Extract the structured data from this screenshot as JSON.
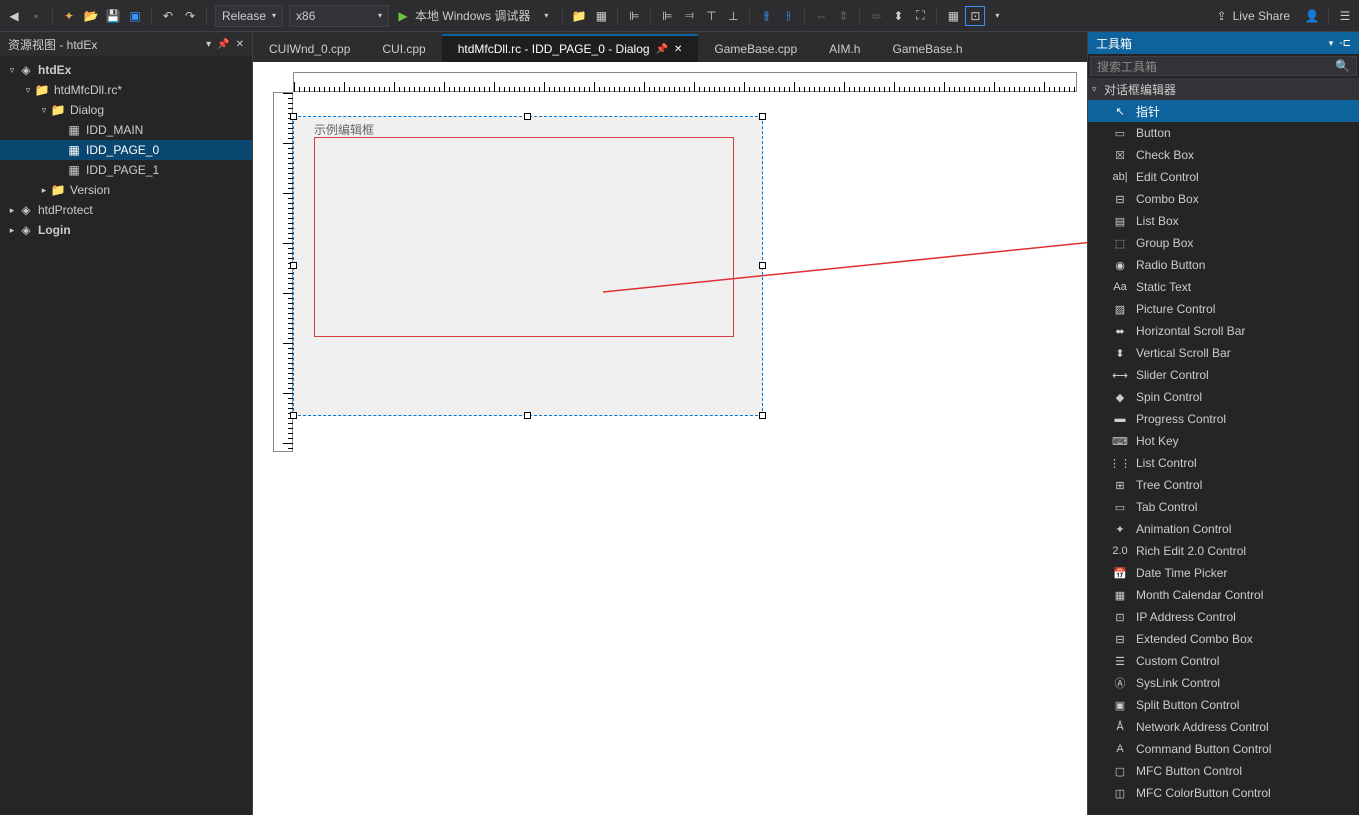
{
  "toolbar": {
    "config_dd": "Release",
    "platform_dd": "x86",
    "debug_btn": "本地 Windows 调试器",
    "live_share": "Live Share"
  },
  "left_panel": {
    "title": "资源视图 - htdEx",
    "tree": [
      {
        "lvl": 0,
        "arrow": "▿",
        "icon": "◈",
        "label": "htdEx",
        "bold": true
      },
      {
        "lvl": 1,
        "arrow": "▿",
        "icon": "📁",
        "label": "htdMfcDll.rc*",
        "bold": false
      },
      {
        "lvl": 2,
        "arrow": "▿",
        "icon": "📁",
        "label": "Dialog",
        "bold": false
      },
      {
        "lvl": 3,
        "arrow": "",
        "icon": "▦",
        "label": "IDD_MAIN",
        "bold": false
      },
      {
        "lvl": 3,
        "arrow": "",
        "icon": "▦",
        "label": "IDD_PAGE_0",
        "bold": false,
        "sel": true
      },
      {
        "lvl": 3,
        "arrow": "",
        "icon": "▦",
        "label": "IDD_PAGE_1",
        "bold": false
      },
      {
        "lvl": 2,
        "arrow": "▸",
        "icon": "📁",
        "label": "Version",
        "bold": false
      },
      {
        "lvl": 0,
        "arrow": "▸",
        "icon": "◈",
        "label": "htdProtect",
        "bold": false
      },
      {
        "lvl": 0,
        "arrow": "▸",
        "icon": "◈",
        "label": "Login",
        "bold": true
      }
    ]
  },
  "tabs": [
    {
      "label": "CUIWnd_0.cpp",
      "active": false
    },
    {
      "label": "CUI.cpp",
      "active": false
    },
    {
      "label": "htdMfcDll.rc - IDD_PAGE_0 - Dialog",
      "active": true
    },
    {
      "label": "GameBase.cpp",
      "active": false
    },
    {
      "label": "AIM.h",
      "active": false
    },
    {
      "label": "GameBase.h",
      "active": false
    }
  ],
  "design": {
    "edit_label": "示例编辑框"
  },
  "right_panel": {
    "title": "工具箱",
    "search_placeholder": "搜索工具箱",
    "category": "对话框编辑器",
    "items": [
      {
        "icon": "↖",
        "label": "指针",
        "sel": true
      },
      {
        "icon": "▭",
        "label": "Button"
      },
      {
        "icon": "☒",
        "label": "Check Box"
      },
      {
        "icon": "ab|",
        "label": "Edit Control"
      },
      {
        "icon": "⊟",
        "label": "Combo Box"
      },
      {
        "icon": "▤",
        "label": "List Box"
      },
      {
        "icon": "⬚",
        "label": "Group Box"
      },
      {
        "icon": "◉",
        "label": "Radio Button"
      },
      {
        "icon": "Aa",
        "label": "Static Text"
      },
      {
        "icon": "▨",
        "label": "Picture Control"
      },
      {
        "icon": "⬌",
        "label": "Horizontal Scroll Bar"
      },
      {
        "icon": "⬍",
        "label": "Vertical Scroll Bar"
      },
      {
        "icon": "⟷",
        "label": "Slider Control"
      },
      {
        "icon": "◆",
        "label": "Spin Control"
      },
      {
        "icon": "▬",
        "label": "Progress Control"
      },
      {
        "icon": "⌨",
        "label": "Hot Key"
      },
      {
        "icon": "⋮⋮",
        "label": "List Control"
      },
      {
        "icon": "⊞",
        "label": "Tree Control"
      },
      {
        "icon": "▭",
        "label": "Tab Control"
      },
      {
        "icon": "✦",
        "label": "Animation Control"
      },
      {
        "icon": "2.0",
        "label": "Rich Edit 2.0 Control"
      },
      {
        "icon": "📅",
        "label": "Date Time Picker"
      },
      {
        "icon": "▦",
        "label": "Month Calendar Control"
      },
      {
        "icon": "⊡",
        "label": "IP Address Control"
      },
      {
        "icon": "⊟",
        "label": "Extended Combo Box"
      },
      {
        "icon": "☰",
        "label": "Custom Control"
      },
      {
        "icon": "Ⓐ",
        "label": "SysLink Control"
      },
      {
        "icon": "▣",
        "label": "Split Button Control"
      },
      {
        "icon": "Å",
        "label": "Network Address Control"
      },
      {
        "icon": "A",
        "label": "Command Button Control"
      },
      {
        "icon": "▢",
        "label": "MFC Button Control"
      },
      {
        "icon": "◫",
        "label": "MFC ColorButton Control"
      }
    ]
  }
}
